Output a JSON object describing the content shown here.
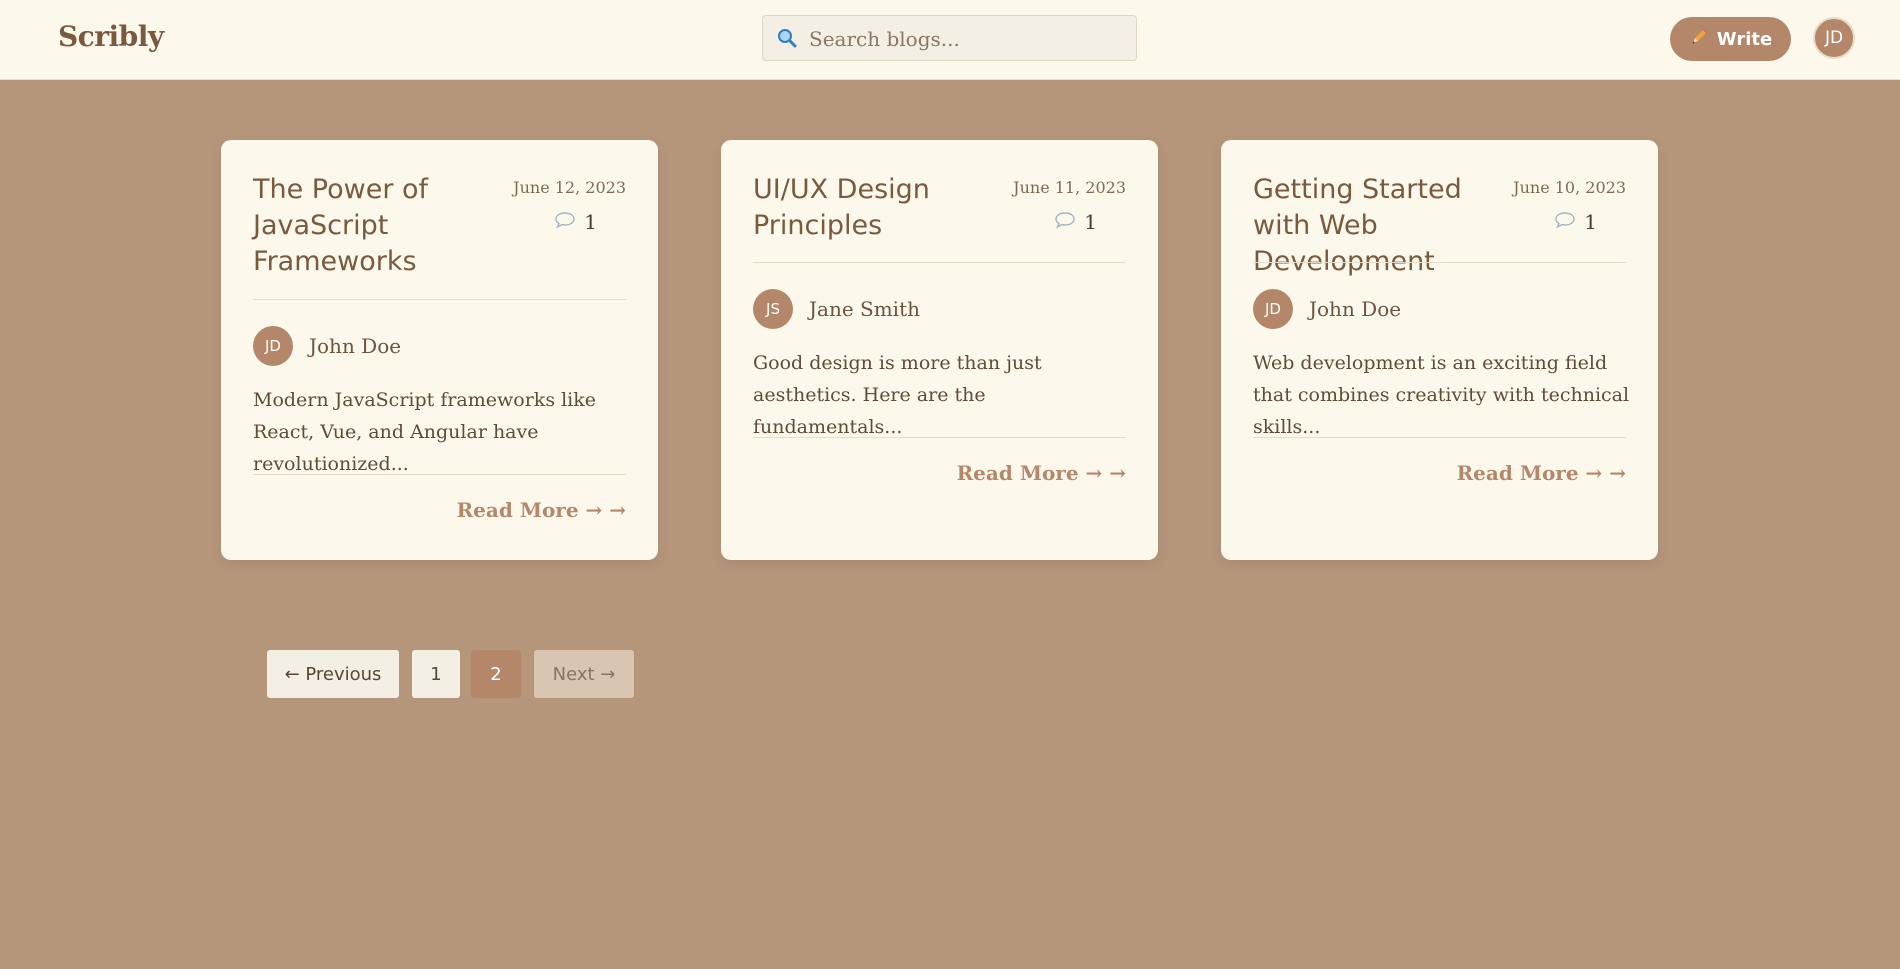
{
  "header": {
    "brand": "Scribly",
    "search_placeholder": "Search blogs...",
    "write_label": "Write",
    "user_initials": "JD"
  },
  "posts": [
    {
      "title": "The Power of JavaScript Frameworks",
      "date": "June 12, 2023",
      "comments": "1",
      "author_initials": "JD",
      "author": "John Doe",
      "excerpt": "Modern JavaScript frameworks like React, Vue, and Angular have revolutionized...",
      "read_more": "Read More → →"
    },
    {
      "title": "UI/UX Design Principles",
      "date": "June 11, 2023",
      "comments": "1",
      "author_initials": "JS",
      "author": "Jane Smith",
      "excerpt": "Good design is more than just aesthetics. Here are the fundamentals...",
      "read_more": "Read More → →"
    },
    {
      "title": "Getting Started with Web Development",
      "date": "June 10, 2023",
      "comments": "1",
      "author_initials": "JD",
      "author": "John Doe",
      "excerpt": "Web development is an exciting field that combines creativity with technical skills...",
      "read_more": "Read More → →"
    }
  ],
  "pagination": {
    "previous": "← Previous",
    "pages": [
      "1",
      "2"
    ],
    "current": "2",
    "next": "Next →"
  },
  "colors": {
    "page_background": "#b5967b",
    "header_background": "#fdf8ec",
    "card_background": "#fdf8ec",
    "accent": "#b5876a",
    "title": "#7a5a3e"
  }
}
